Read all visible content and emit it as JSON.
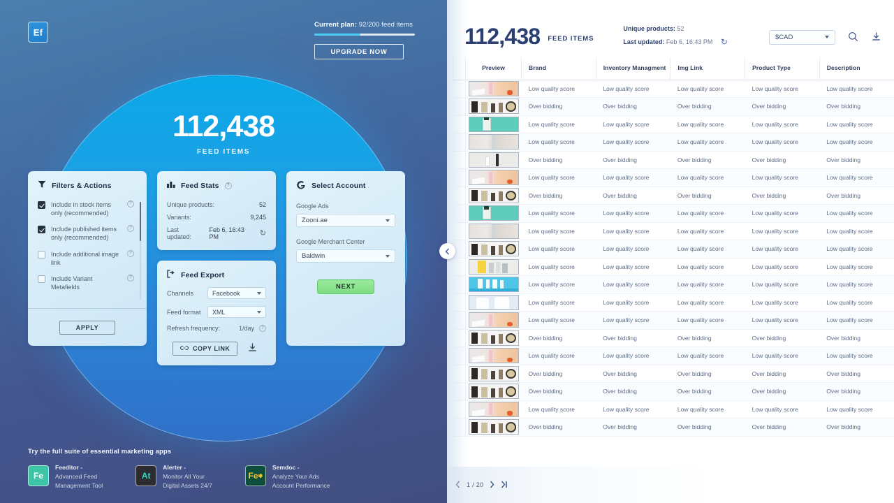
{
  "left": {
    "logo_text": "Ef",
    "plan": {
      "label": "Current plan:",
      "value": "92/200 feed items",
      "progress_percent": 46,
      "upgrade_label": "UPGRADE NOW"
    },
    "hero": {
      "number": "112,438",
      "label": "FEED ITEMS"
    },
    "filters_card": {
      "title": "Filters & Actions",
      "icon": "funnel-icon",
      "items": [
        {
          "label": "Include in stock items only (recommended)",
          "checked": true
        },
        {
          "label": "Include published items only (recommended)",
          "checked": true
        },
        {
          "label": "Include additional image link",
          "checked": false
        },
        {
          "label": "Include Variant Metafields",
          "checked": false
        }
      ],
      "apply_label": "APPLY"
    },
    "stats_card": {
      "title": "Feed Stats",
      "icon": "bar-chart-icon",
      "rows": [
        {
          "label": "Unique products:",
          "value": "52"
        },
        {
          "label": "Variants:",
          "value": "9,245"
        }
      ],
      "updated_label": "Last updated:",
      "updated_value": "Feb 6, 16:43 PM"
    },
    "export_card": {
      "title": "Feed Export",
      "icon": "export-icon",
      "channels_label": "Channels",
      "channels_value": "Facebook",
      "format_label": "Feed format",
      "format_value": "XML",
      "refresh_label": "Refresh frequency:",
      "refresh_value": "1/day",
      "copy_label": "COPY LINK"
    },
    "account_card": {
      "title": "Select Account",
      "icon": "google-g-icon",
      "ads_label": "Google Ads",
      "ads_value": "Zooni.ae",
      "merchant_label": "Google Merchant Center",
      "merchant_value": "Baldwin",
      "next_label": "NEXT"
    },
    "suite": {
      "title": "Try the full suite of essential marketing apps",
      "apps": [
        {
          "icon_text": "Fe",
          "icon_bg": "#3ec5a7",
          "icon_fg": "#ffffff",
          "name": "Feeditor -",
          "desc1": "Advanced Feed",
          "desc2": "Management Tool"
        },
        {
          "icon_text": "At",
          "icon_bg": "#2b2b30",
          "icon_fg": "#2fe0c8",
          "name": "Alerter -",
          "desc1": "Monitor All Your",
          "desc2": "Digital Assets 24/7"
        },
        {
          "icon_text": "Fe",
          "icon_bg": "#0d4e3c",
          "icon_fg": "#f2c93d",
          "name": "Semdoc -",
          "desc1": "Analyze Your Ads",
          "desc2": "Account Performance"
        }
      ]
    }
  },
  "right": {
    "header": {
      "number": "112,438",
      "number_label": "FEED ITEMS",
      "unique_label": "Unique products:",
      "unique_value": "52",
      "updated_label": "Last updated:",
      "updated_value": "Feb 6, 16:43 PM",
      "refresh_icon": "refresh-icon",
      "currency_value": "$CAD",
      "search_icon": "search-icon",
      "download_icon": "download-icon"
    },
    "collapse_icon": "chevron-left-icon",
    "table": {
      "columns": [
        "Preview",
        "Brand",
        "Inventory Managment",
        "Img Link",
        "Product Type",
        "Description"
      ],
      "rows": [
        {
          "status": "Low quality score",
          "thumb": "pink-bottle-peach"
        },
        {
          "status": "Over bidding",
          "thumb": "cosmetics-shelf"
        },
        {
          "status": "Low quality score",
          "thumb": "teal-serum"
        },
        {
          "status": "Low quality score",
          "thumb": "beige-bottle"
        },
        {
          "status": "Over bidding",
          "thumb": "white-pump"
        },
        {
          "status": "Low quality score",
          "thumb": "pink-bottle-peach"
        },
        {
          "status": "Over bidding",
          "thumb": "cosmetics-shelf"
        },
        {
          "status": "Low quality score",
          "thumb": "teal-serum"
        },
        {
          "status": "Low quality score",
          "thumb": "beige-bottle"
        },
        {
          "status": "Low quality score",
          "thumb": "cosmetics-shelf"
        },
        {
          "status": "Low quality score",
          "thumb": "yellow-shelf"
        },
        {
          "status": "Low quality score",
          "thumb": "cyan-bottles"
        },
        {
          "status": "Low quality score",
          "thumb": "dove-pair"
        },
        {
          "status": "Low quality score",
          "thumb": "pink-bottle-peach"
        },
        {
          "status": "Over bidding",
          "thumb": "cosmetics-shelf"
        },
        {
          "status": "Low quality score",
          "thumb": "pink-bottle-peach"
        },
        {
          "status": "Over bidding",
          "thumb": "cosmetics-shelf"
        },
        {
          "status": "Over bidding",
          "thumb": "cosmetics-shelf"
        },
        {
          "status": "Low quality score",
          "thumb": "pink-bottle-peach"
        },
        {
          "status": "Over bidding",
          "thumb": "cosmetics-shelf"
        }
      ]
    },
    "pagination": {
      "prev_icon": "chevron-left-icon",
      "text": "1 / 20",
      "next_icon": "chevron-right-icon",
      "last_icon": "chevron-last-icon"
    }
  }
}
